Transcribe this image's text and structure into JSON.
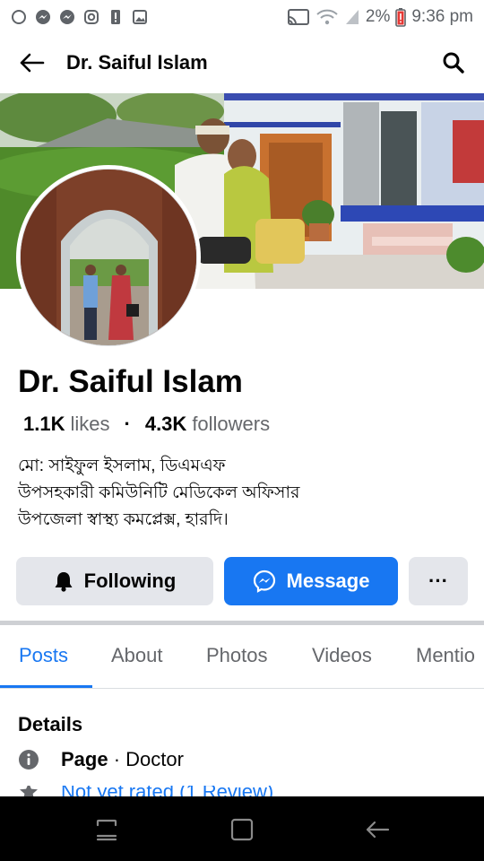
{
  "status_bar": {
    "battery": "2%",
    "time": "9:36 pm"
  },
  "header": {
    "title": "Dr. Saiful Islam"
  },
  "profile": {
    "name": "Dr. Saiful Islam",
    "likes_count": "1.1K",
    "likes_label": "likes",
    "separator": "·",
    "followers_count": "4.3K",
    "followers_label": "followers",
    "bio_lines": [
      "মো: সাইফুল ইসলাম, ডিএমএফ",
      "উপসহকারী কমিউনিটি মেডিকেল অফিসার",
      "উপজেলা স্বাস্থ্য কমপ্লেক্স, হারদি।"
    ]
  },
  "actions": {
    "following_label": "Following",
    "message_label": "Message",
    "more_label": "···"
  },
  "tabs": [
    {
      "label": "Posts",
      "active": true
    },
    {
      "label": "About",
      "active": false
    },
    {
      "label": "Photos",
      "active": false
    },
    {
      "label": "Videos",
      "active": false
    },
    {
      "label": "Mentio",
      "active": false
    }
  ],
  "details": {
    "title": "Details",
    "page_label": "Page",
    "page_separator": " · ",
    "page_category": "Doctor",
    "rating_text": "Not yet rated (1 Review)"
  },
  "colors": {
    "accent": "#1877f2",
    "button_gray": "#e4e6eb",
    "secondary_text": "#65676b"
  }
}
